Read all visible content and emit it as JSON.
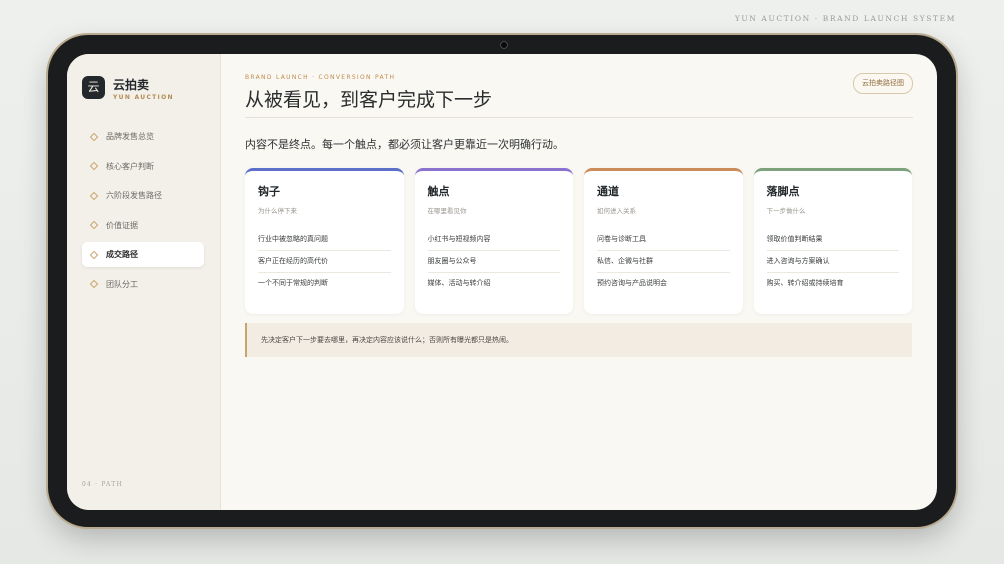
{
  "header_right": "YUN AUCTION · BRAND LAUNCH SYSTEM",
  "brand": {
    "logo_char": "云",
    "name": "云拍卖",
    "sub": "YUN AUCTION"
  },
  "sidebar": {
    "items": [
      {
        "label": "品牌发售总览",
        "active": false
      },
      {
        "label": "核心客户判断",
        "active": false
      },
      {
        "label": "六阶段发售路径",
        "active": false
      },
      {
        "label": "价值证据",
        "active": false
      },
      {
        "label": "成交路径",
        "active": true
      },
      {
        "label": "团队分工",
        "active": false
      }
    ],
    "footer": "04 · PATH"
  },
  "main": {
    "eyebrow": "BRAND LAUNCH · CONVERSION PATH",
    "title": "从被看见，到客户完成下一步",
    "top_button": "云拍卖路径图",
    "lead": "内容不是终点。每一个触点，都必须让客户更靠近一次明确行动。",
    "cards": [
      {
        "title": "钩子",
        "sub": "为什么停下来",
        "color": "#5c6fc9",
        "items": [
          "行业中被忽略的真问题",
          "客户正在经历的高代价",
          "一个不同于常规的判断"
        ]
      },
      {
        "title": "触点",
        "sub": "在哪里看见你",
        "color": "#8b72cf",
        "items": [
          "小红书与短视频内容",
          "朋友圈与公众号",
          "媒体、活动与转介绍"
        ]
      },
      {
        "title": "通道",
        "sub": "如何进入关系",
        "color": "#cc8b5a",
        "items": [
          "问卷与诊断工具",
          "私信、企微与社群",
          "预约咨询与产品说明会"
        ]
      },
      {
        "title": "落脚点",
        "sub": "下一步做什么",
        "color": "#7ea27c",
        "items": [
          "领取价值判断结果",
          "进入咨询与方案确认",
          "购买、转介绍或持续培育"
        ]
      }
    ],
    "note": "先决定客户下一步要去哪里，再决定内容应该说什么；否则所有曝光都只是热闹。"
  }
}
